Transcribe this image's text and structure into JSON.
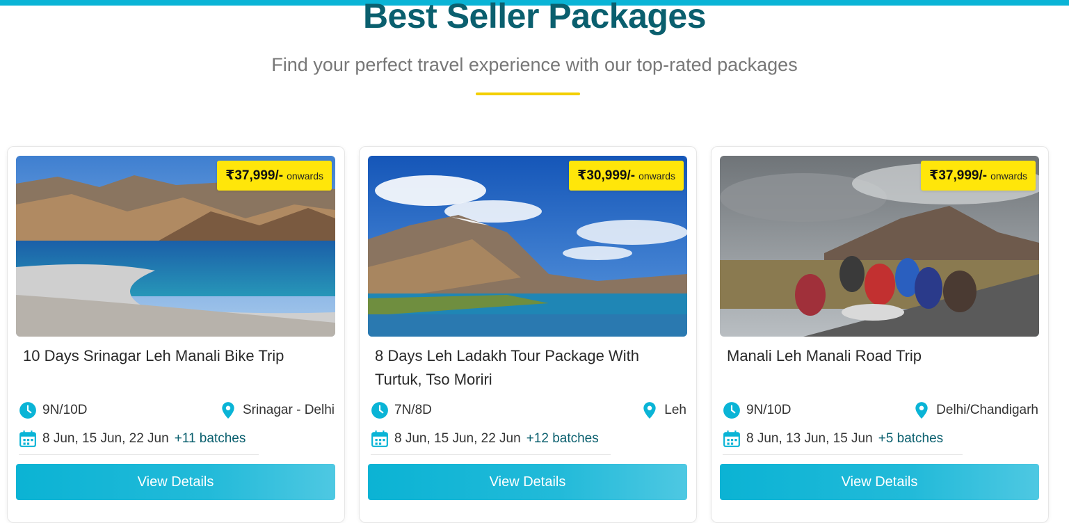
{
  "section": {
    "heading": "Best Seller Packages",
    "subheading": "Find your perfect travel experience with our top-rated packages"
  },
  "colors": {
    "accent": "#0ab4d6",
    "heading": "#0a5f6e",
    "badge": "#ffe60a",
    "underline": "#f3cf00"
  },
  "icons": {
    "duration": "clock-icon",
    "location": "map-pin-icon",
    "dates": "calendar-icon"
  },
  "cards": [
    {
      "image": "pangong-lake-landscape",
      "price": "₹37,999/-",
      "price_suffix": "onwards",
      "title": "10 Days Srinagar Leh Manali Bike Trip",
      "duration": "9N/10D",
      "location": "Srinagar - Delhi",
      "dates": "8 Jun, 15 Jun, 22 Jun",
      "batches": "+11 batches",
      "button": "View Details"
    },
    {
      "image": "mountain-lake-landscape",
      "price": "₹30,999/-",
      "price_suffix": "onwards",
      "title": "8 Days Leh Ladakh Tour Package With Turtuk, Tso Moriri",
      "duration": "7N/8D",
      "location": "Leh",
      "dates": "8 Jun, 15 Jun, 22 Jun",
      "batches": "+12 batches",
      "button": "View Details"
    },
    {
      "image": "group-road-trip-photo",
      "price": "₹37,999/-",
      "price_suffix": "onwards",
      "title": "Manali Leh Manali Road Trip",
      "duration": "9N/10D",
      "location": "Delhi/Chandigarh",
      "dates": "8 Jun, 13 Jun, 15 Jun",
      "batches": "+5 batches",
      "button": "View Details"
    }
  ]
}
